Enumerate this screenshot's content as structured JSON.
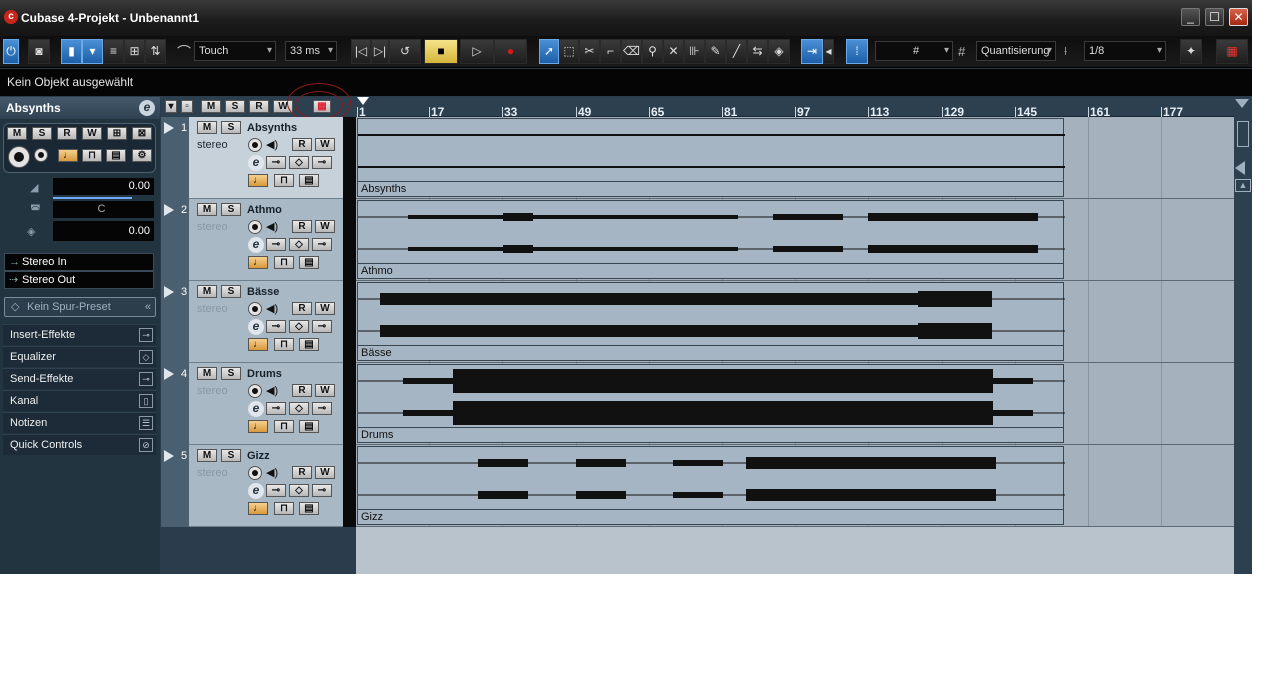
{
  "window": {
    "title": "Cubase 4-Projekt - Unbenannt1",
    "minimize": "_",
    "maximize": "☐",
    "close": "✕"
  },
  "toolbar": {
    "automation_mode": "Touch",
    "preroll": "33 ms",
    "snap_grid_symbol": "#",
    "quantize_label": "Quantisierung",
    "quantize_value": "1/8"
  },
  "infoline": {
    "text": "Kein Objekt ausgewählt"
  },
  "inspector": {
    "track_name": "Absynths",
    "volume": "0.00",
    "pan": "C",
    "delay": "0.00",
    "input": "Stereo In",
    "output": "Stereo Out",
    "preset": "Kein Spur-Preset",
    "sections": [
      "Insert-Effekte",
      "Equalizer",
      "Send-Effekte",
      "Kanal",
      "Notizen",
      "Quick Controls"
    ]
  },
  "ruler": {
    "ticks": [
      "1",
      "17",
      "33",
      "49",
      "65",
      "81",
      "97",
      "113",
      "129",
      "145",
      "161",
      "177"
    ]
  },
  "tracks": [
    {
      "num": "1",
      "name": "Absynths",
      "type": "stereo",
      "part": "Absynths"
    },
    {
      "num": "2",
      "name": "Athmo",
      "type": "stereo",
      "part": "Athmo"
    },
    {
      "num": "3",
      "name": "Bässe",
      "type": "stereo",
      "part": "Bässe"
    },
    {
      "num": "4",
      "name": "Drums",
      "type": "stereo",
      "part": "Drums"
    },
    {
      "num": "5",
      "name": "Gizz",
      "type": "stereo",
      "part": "Gizz"
    }
  ],
  "colors": {
    "accent": "#1c5fa8",
    "record": "#d21a1a",
    "track_bg": "#a9b8c5"
  }
}
